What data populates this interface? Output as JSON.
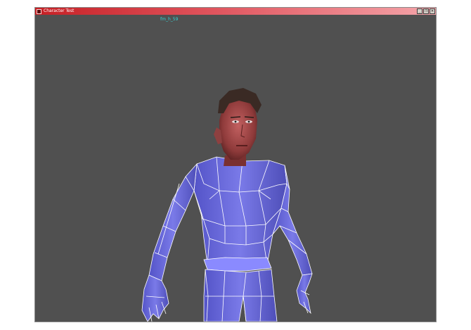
{
  "window": {
    "title": "Character Test",
    "buttons": {
      "minimize": "_",
      "restore": "❐",
      "close": "✕"
    }
  },
  "viewport": {
    "animation_label": "fm_h_59",
    "background_color": "#505050",
    "label_color": "#34d6d6",
    "mesh_color": "#6666dd",
    "wireframe_color": "#ffffff"
  }
}
